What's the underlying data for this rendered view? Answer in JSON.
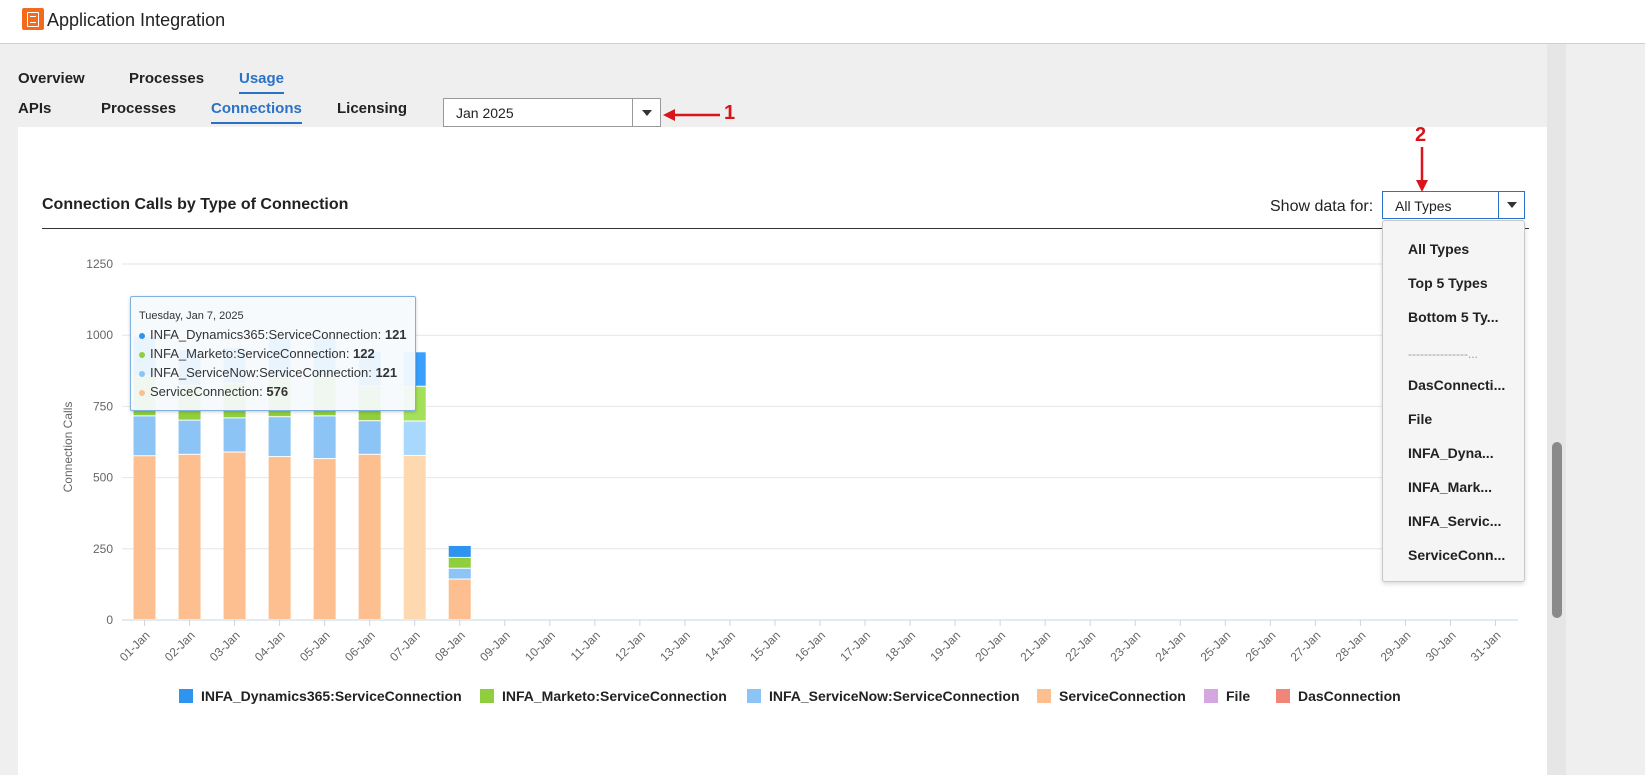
{
  "app": {
    "title": "Application Integration"
  },
  "tabs": [
    {
      "label": "Overview"
    },
    {
      "label": "Processes"
    },
    {
      "label": "Usage",
      "active": true
    }
  ],
  "subtabs": [
    {
      "label": "APIs"
    },
    {
      "label": "Processes"
    },
    {
      "label": "Connections",
      "active": true
    },
    {
      "label": "Licensing"
    }
  ],
  "month_select": {
    "value": "Jan 2025"
  },
  "annotations": {
    "one": "1",
    "two": "2"
  },
  "chart_panel": {
    "title": "Connection Calls by Type of Connection",
    "show_data_label": "Show data for:",
    "type_select": {
      "value": "All Types"
    },
    "dropdown": {
      "items": [
        "All Types",
        "Top 5 Types",
        "Bottom 5 Ty...",
        "DasConnecti...",
        "File",
        "INFA_Dyna...",
        "INFA_Mark...",
        "INFA_Servic...",
        "ServiceConn..."
      ],
      "separator": "---------------..."
    }
  },
  "tooltip": {
    "date": "Tuesday, Jan 7, 2025",
    "rows": [
      {
        "name": "INFA_Dynamics365:ServiceConnection",
        "sep": ": ",
        "value": "121",
        "color": "#2f93f0"
      },
      {
        "name": "INFA_Marketo:ServiceConnection",
        "sep": ": ",
        "value": "122",
        "color": "#8fce3c"
      },
      {
        "name": "INFA_ServiceNow:ServiceConnection",
        "sep": ": ",
        "value": "121",
        "color": "#8cc4f5"
      },
      {
        "name": "ServiceConnection",
        "sep": ": ",
        "value": "576",
        "color": "#fdbf8f"
      }
    ]
  },
  "chart_data": {
    "type": "bar",
    "stacked": true,
    "ylabel": "Connection Calls",
    "ylim": [
      0,
      1250
    ],
    "yticks": [
      0,
      250,
      500,
      750,
      1000,
      1250
    ],
    "categories": [
      "01-Jan",
      "02-Jan",
      "03-Jan",
      "04-Jan",
      "05-Jan",
      "06-Jan",
      "07-Jan",
      "08-Jan",
      "09-Jan",
      "10-Jan",
      "11-Jan",
      "12-Jan",
      "13-Jan",
      "14-Jan",
      "15-Jan",
      "16-Jan",
      "17-Jan",
      "18-Jan",
      "19-Jan",
      "20-Jan",
      "21-Jan",
      "22-Jan",
      "23-Jan",
      "24-Jan",
      "25-Jan",
      "26-Jan",
      "27-Jan",
      "28-Jan",
      "29-Jan",
      "30-Jan",
      "31-Jan"
    ],
    "highlight_index": 6,
    "series": [
      {
        "name": "ServiceConnection",
        "color": "#fdbf8f",
        "highlight_color": "#fed8ae",
        "values": [
          575,
          580,
          588,
          572,
          565,
          580,
          576,
          142,
          0,
          0,
          0,
          0,
          0,
          0,
          0,
          0,
          0,
          0,
          0,
          0,
          0,
          0,
          0,
          0,
          0,
          0,
          0,
          0,
          0,
          0,
          0
        ]
      },
      {
        "name": "INFA_ServiceNow:ServiceConnection",
        "color": "#8cc4f5",
        "highlight_color": "#a9d8ff",
        "values": [
          140,
          120,
          120,
          140,
          150,
          118,
          121,
          38,
          0,
          0,
          0,
          0,
          0,
          0,
          0,
          0,
          0,
          0,
          0,
          0,
          0,
          0,
          0,
          0,
          0,
          0,
          0,
          0,
          0,
          0,
          0
        ]
      },
      {
        "name": "INFA_Marketo:ServiceConnection",
        "color": "#8fce3c",
        "highlight_color": "#a4e05a",
        "values": [
          140,
          122,
          122,
          140,
          140,
          122,
          122,
          38,
          0,
          0,
          0,
          0,
          0,
          0,
          0,
          0,
          0,
          0,
          0,
          0,
          0,
          0,
          0,
          0,
          0,
          0,
          0,
          0,
          0,
          0,
          0
        ]
      },
      {
        "name": "INFA_Dynamics365:ServiceConnection",
        "color": "#2f93f0",
        "highlight_color": "#3aa0ff",
        "values": [
          140,
          125,
          125,
          140,
          140,
          122,
          121,
          42,
          0,
          0,
          0,
          0,
          0,
          0,
          0,
          0,
          0,
          0,
          0,
          0,
          0,
          0,
          0,
          0,
          0,
          0,
          0,
          0,
          0,
          0,
          0
        ]
      }
    ],
    "legend": [
      {
        "name": "INFA_Dynamics365:ServiceConnection",
        "color": "#2f93f0"
      },
      {
        "name": "INFA_Marketo:ServiceConnection",
        "color": "#8fce3c"
      },
      {
        "name": "INFA_ServiceNow:ServiceConnection",
        "color": "#8cc4f5"
      },
      {
        "name": "ServiceConnection",
        "color": "#fdbf8f"
      },
      {
        "name": "File",
        "color": "#d6a6e0"
      },
      {
        "name": "DasConnection",
        "color": "#f0857a"
      }
    ],
    "legend_placement": "bottom"
  }
}
